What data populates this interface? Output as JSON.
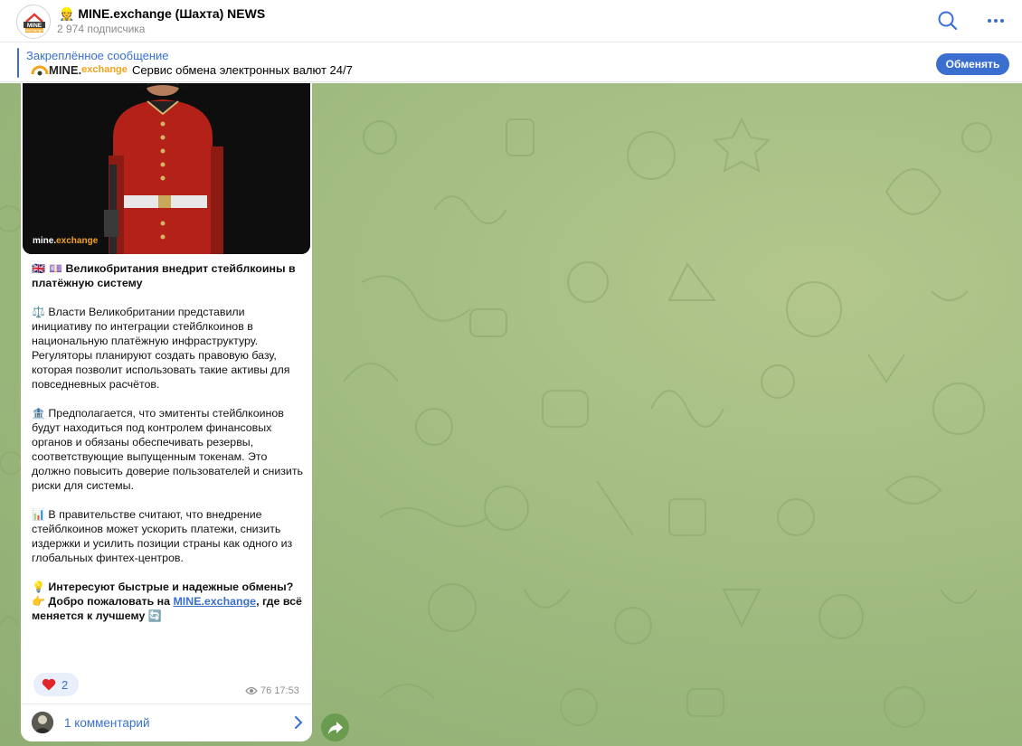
{
  "header": {
    "title": "👷 MINE.exchange (Шахта) NEWS",
    "subscribers": "2 974 подписчика",
    "logo_text": "MINE",
    "logo_sub": "exchange"
  },
  "pinned": {
    "label": "Закреплённое сообщение",
    "logo_main": "MINE.",
    "logo_accent": "exchange",
    "text": "Сервис обмена электронных валют 24/7",
    "button_label": "Обменять"
  },
  "post": {
    "watermark_main": "mine.",
    "watermark_accent": "exchange",
    "headline_emoji": "🇬🇧 💷",
    "headline": "Великобритания внедрит стейблкоины в платёжную систему",
    "p1_emoji": "⚖️",
    "p1": "Власти Великобритании представили инициативу по интеграции стейблкоинов в национальную платёжную инфраструктуру. Регуляторы планируют создать правовую базу, которая позволит использовать такие активы для повседневных расчётов.",
    "p2_emoji": "🏦",
    "p2": "Предполагается, что эмитенты стейблкоинов будут находиться под контролем финансовых органов и обязаны обеспечивать резервы, соответствующие выпущенным токенам. Это должно повысить доверие пользователей и снизить риски для системы.",
    "p3_emoji": "📊",
    "p3": "В правительстве считают, что внедрение стейблкоинов может ускорить платежи, снизить издержки и усилить позиции страны как одного из глобальных финтех-центров.",
    "cta_emoji": "💡",
    "cta_a": "Интересуют быстрые и надежные обмены?",
    "cta_hand": "👉",
    "cta_b": "Добро пожаловать на",
    "cta_link": "MINE.exchange",
    "cta_c": ", где всё меняется к лучшему",
    "cta_end": "🔄",
    "reaction_emoji": "❤️",
    "reaction_count": "2",
    "views": "76",
    "time": "17:53",
    "comments_label": "1 комментарий"
  },
  "icons": {
    "search": "search-icon",
    "more": "more-icon",
    "views": "eye-icon",
    "chevron": "chevron-right-icon",
    "forward": "forward-arrow-icon"
  },
  "colors": {
    "accent": "#3a6fd0",
    "brand_orange": "#f4a21c",
    "background_green": "#a5be84"
  }
}
